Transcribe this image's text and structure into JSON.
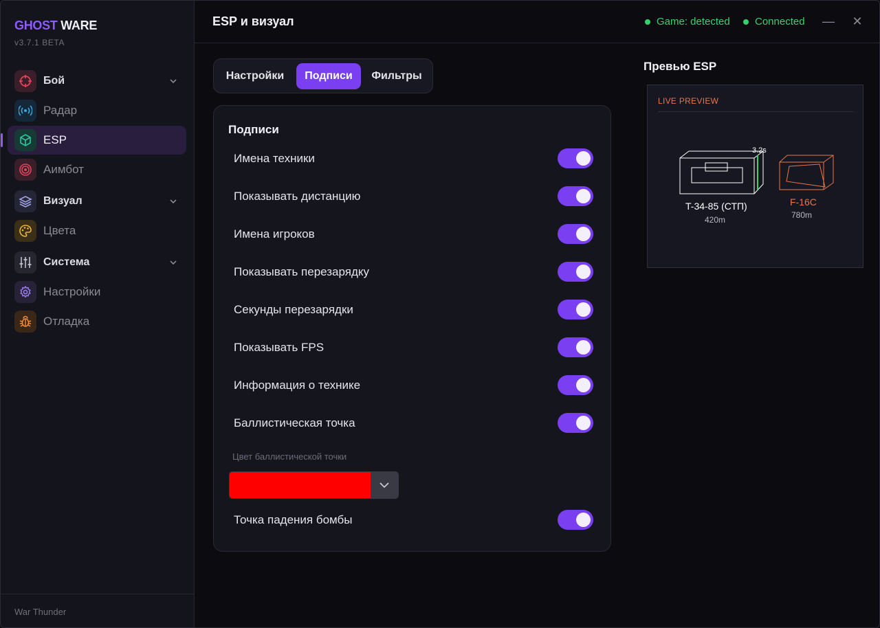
{
  "brand": {
    "part1": "GHOST",
    "part2": "WARE",
    "version": "v3.7.1 BETA"
  },
  "sidebar": {
    "items": [
      {
        "label": "Бой",
        "type": "group",
        "icon": "crosshair-icon",
        "color": "#e0435a"
      },
      {
        "label": "Радар",
        "type": "sub",
        "icon": "radar-icon",
        "color": "#3aa7e6"
      },
      {
        "label": "ESP",
        "type": "active",
        "icon": "cube-icon",
        "color": "#2fc4a0"
      },
      {
        "label": "Аимбот",
        "type": "sub",
        "icon": "target-icon",
        "color": "#e0435a"
      },
      {
        "label": "Визуал",
        "type": "group",
        "icon": "layers-icon",
        "color": "#8a8fd8"
      },
      {
        "label": "Цвета",
        "type": "sub",
        "icon": "palette-icon",
        "color": "#f0b43a"
      },
      {
        "label": "Система",
        "type": "group",
        "icon": "sliders-icon",
        "color": "#b0b0c0"
      },
      {
        "label": "Настройки",
        "type": "sub",
        "icon": "gear-icon",
        "color": "#9a7cf0"
      },
      {
        "label": "Отладка",
        "type": "sub",
        "icon": "bug-icon",
        "color": "#f08a3a"
      }
    ],
    "footer": "War Thunder"
  },
  "header": {
    "title": "ESP и визуал",
    "status_game": "Game: detected",
    "status_conn": "Connected",
    "minimize": "—",
    "close": "✕"
  },
  "tabs": [
    {
      "label": "Настройки",
      "active": false
    },
    {
      "label": "Подписи",
      "active": true
    },
    {
      "label": "Фильтры",
      "active": false
    }
  ],
  "panel": {
    "title": "Подписи",
    "toggles": [
      {
        "label": "Имена техники",
        "on": true
      },
      {
        "label": "Показывать дистанцию",
        "on": true
      },
      {
        "label": "Имена игроков",
        "on": true
      },
      {
        "label": "Показывать перезарядку",
        "on": true
      },
      {
        "label": "Секунды перезарядки",
        "on": true
      },
      {
        "label": "Показывать FPS",
        "on": true
      },
      {
        "label": "Информация о технике",
        "on": true
      },
      {
        "label": "Баллистическая точка",
        "on": true
      }
    ],
    "color_label": "Цвет баллистической точки",
    "color_value": "#ff0000",
    "last_toggle": {
      "label": "Точка падения бомбы",
      "on": true
    }
  },
  "preview": {
    "title": "Превью ESP",
    "badge": "LIVE PREVIEW",
    "tank": {
      "name": "T-34-85 (СТП)",
      "distance": "420m",
      "reload": "3.2s",
      "color": "#ffffff"
    },
    "plane": {
      "name": "F-16C",
      "distance": "780m",
      "color": "#e8764a"
    }
  }
}
